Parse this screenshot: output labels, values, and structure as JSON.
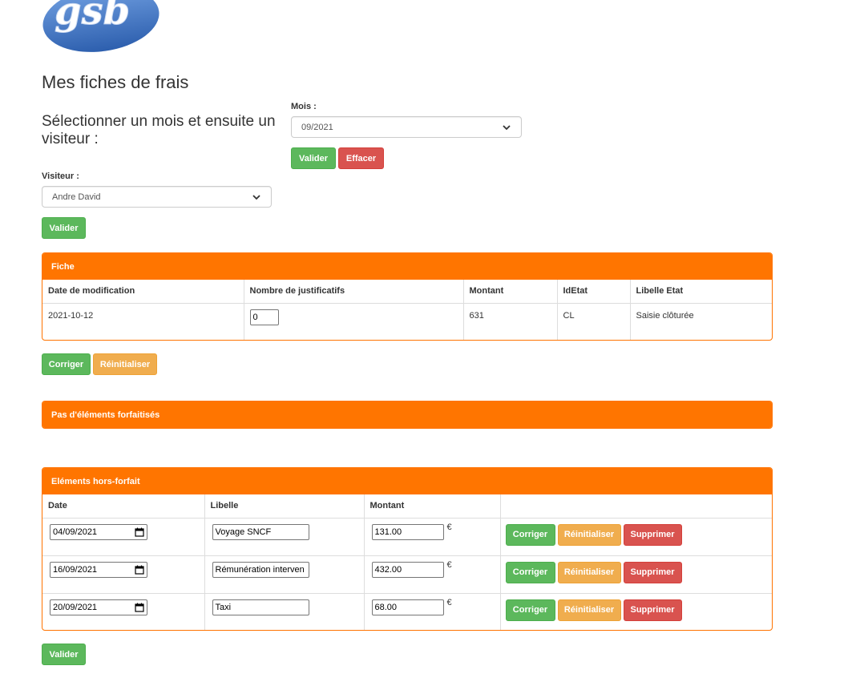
{
  "logo": {
    "text": "gsb",
    "colors": {
      "oval": "#3f74c2",
      "letters": "#ffffff"
    }
  },
  "page_title": "Mes fiches de frais",
  "subtitle": "Sélectionner un mois et ensuite un visiteur :",
  "mois": {
    "label": "Mois :",
    "selected": "09/2021",
    "valider_label": "Valider",
    "effacer_label": "Effacer"
  },
  "visiteur": {
    "label": "Visiteur :",
    "selected": "Andre David",
    "valider_label": "Valider"
  },
  "fiche": {
    "heading": "Fiche",
    "headers": [
      "Date de modification",
      "Nombre de justificatifs",
      "Montant",
      "IdEtat",
      "Libelle Etat"
    ],
    "row": {
      "date_modification": "2021-10-12",
      "nb_justificatifs": "0",
      "montant": "631",
      "id_etat": "CL",
      "libelle_etat": "Saisie clôturée"
    },
    "corriger_label": "Corriger",
    "reinitialiser_label": "Réinitialiser"
  },
  "forfait": {
    "heading": "Pas d'éléments forfaitisés"
  },
  "hors_forfait": {
    "heading": "Eléments hors-forfait",
    "headers": [
      "Date",
      "Libelle",
      "Montant",
      ""
    ],
    "currency": "€",
    "rows": [
      {
        "date": "04/09/2021",
        "libelle": "Voyage SNCF",
        "montant": "131.00"
      },
      {
        "date": "16/09/2021",
        "libelle": "Rémunération interven",
        "montant": "432.00"
      },
      {
        "date": "20/09/2021",
        "libelle": "Taxi",
        "montant": "68.00"
      }
    ],
    "corriger_label": "Corriger",
    "reinitialiser_label": "Réinitialiser",
    "supprimer_label": "Supprimer",
    "valider_label": "Valider"
  },
  "colors": {
    "accent_orange": "#ff7500",
    "success_green": "#5cb85c",
    "warning_orange": "#f0ad4e",
    "danger_red": "#d9534f"
  },
  "icons": {
    "select_arrow": "chevron-down-icon",
    "date_picker": "calendar-icon"
  }
}
